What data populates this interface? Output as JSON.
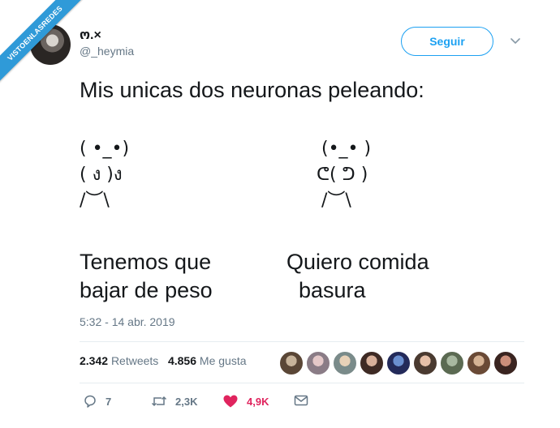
{
  "watermark": "VISTOENLASREDES",
  "tweet": {
    "display_name": "ო.×",
    "handle": "@_heymia",
    "follow_label": "Seguir",
    "text": "Mis unicas dos neuronas peleando:",
    "left_figure": {
      "line1": "( •_•)",
      "line2": "( ง )ง",
      "line3": "/︶\\"
    },
    "right_figure": {
      "line1": "(•_• )",
      "line2": "ᕦ( ᕤ )",
      "line3": "/︶\\"
    },
    "left_caption": "Tenemos que\nbajar de peso",
    "right_caption": "Quiero comida\n  basura",
    "timestamp": "5:32 - 14 abr. 2019"
  },
  "stats": {
    "retweets_count": "2.342",
    "retweets_label": "Retweets",
    "likes_count": "4.856",
    "likes_label": "Me gusta"
  },
  "actions": {
    "replies": "7",
    "retweets": "2,3K",
    "likes": "4,9K"
  },
  "colors": {
    "accent": "#1da1f2",
    "like": "#e0245e",
    "muted": "#657786"
  }
}
